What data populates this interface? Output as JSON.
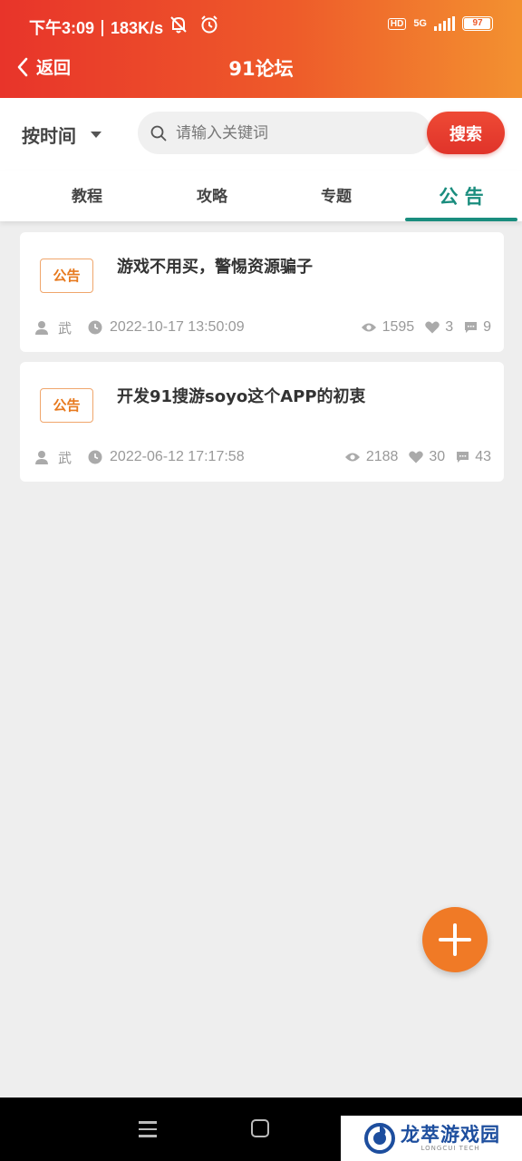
{
  "status_bar": {
    "time": "下午3:09",
    "speed": "183K/s",
    "hd": "HD",
    "network": "5G",
    "battery": "97"
  },
  "nav": {
    "back_label": "返回",
    "title": "91论坛"
  },
  "search": {
    "sort_label": "按时间",
    "placeholder": "请输入关键词",
    "button_label": "搜索"
  },
  "tabs": [
    {
      "label": "教程",
      "active": false
    },
    {
      "label": "攻略",
      "active": false
    },
    {
      "label": "专题",
      "active": false
    },
    {
      "label": "公 告",
      "active": true
    }
  ],
  "posts": [
    {
      "badge": "公告",
      "title": "游戏不用买，警惕资源骗子",
      "author": "武",
      "date": "2022-10-17  13:50:09",
      "views": "1595",
      "likes": "3",
      "comments": "9"
    },
    {
      "badge": "公告",
      "title": "开发91搜游soyo这个APP的初衷",
      "author": "武",
      "date": "2022-06-12  17:17:58",
      "views": "2188",
      "likes": "30",
      "comments": "43"
    }
  ],
  "watermark": {
    "name": "龙萃游戏园",
    "sub": "LONGCUI TECH"
  },
  "colors": {
    "header_start": "#e8342a",
    "header_end": "#f39130",
    "accent_tab": "#1a8d7e",
    "badge": "#e7791e",
    "fab": "#f07a26"
  }
}
